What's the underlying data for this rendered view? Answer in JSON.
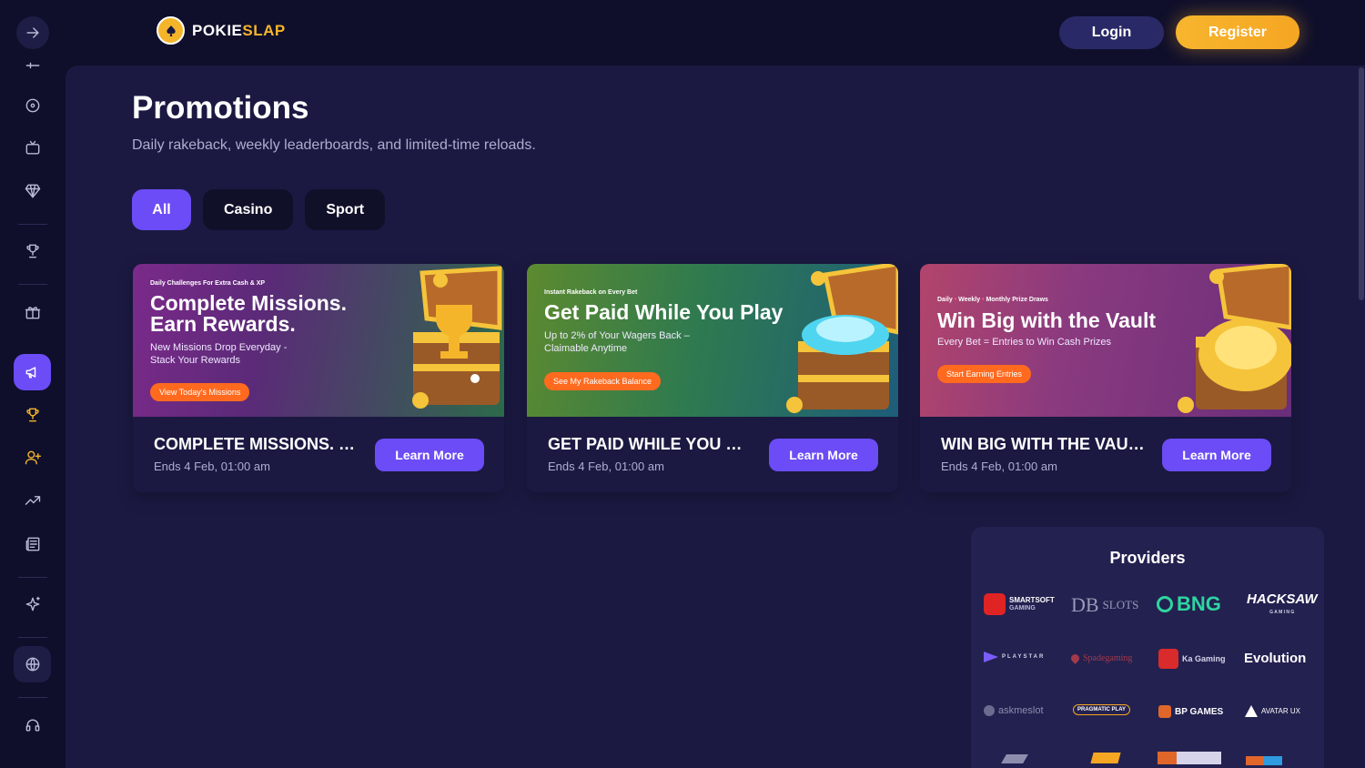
{
  "brand": {
    "name_part1": "POKIE",
    "name_part2": "SLAP"
  },
  "header": {
    "login_label": "Login",
    "register_label": "Register"
  },
  "page": {
    "title": "Promotions",
    "subtitle": "Daily rakeback, weekly leaderboards, and limited-time reloads."
  },
  "tabs": [
    {
      "label": "All",
      "active": true
    },
    {
      "label": "Casino",
      "active": false
    },
    {
      "label": "Sport",
      "active": false
    }
  ],
  "sidebar": {
    "icons": [
      "arrow-right-icon",
      "sliders-icon",
      "roulette-icon",
      "tv-icon",
      "diamond-icon",
      "trophy-icon",
      "gift-icon",
      "megaphone-icon",
      "cup-icon",
      "user-plus-icon",
      "trending-up-icon",
      "newspaper-icon",
      "sparkles-icon",
      "globe-icon",
      "headset-icon"
    ],
    "accent_gold": "#f5b52b",
    "accent_purple": "#6b4cf6"
  },
  "promotions": [
    {
      "kicker": "Daily Challenges For Extra Cash & XP",
      "banner_title_1": "Complete Missions.",
      "banner_title_2": "Earn Rewards.",
      "banner_sub_1": "New Missions Drop Everyday -",
      "banner_sub_2": "Stack Your Rewards",
      "banner_cta": "View Today's Missions",
      "title": "COMPLETE MISSIONS. EARN REWARDS.",
      "ends": "Ends 4 Feb, 01:00 am",
      "button": "Learn More"
    },
    {
      "kicker": "Instant Rakeback on Every Bet",
      "banner_title_1": "Get Paid While You Play",
      "banner_sub_1": "Up to 2% of Your Wagers Back –",
      "banner_sub_2": "Claimable Anytime",
      "banner_cta": "See My Rakeback Balance",
      "title": "GET PAID WHILE YOU PLAY",
      "ends": "Ends 4 Feb, 01:00 am",
      "button": "Learn More"
    },
    {
      "kicker_1": "Daily",
      "kicker_2": "Weekly",
      "kicker_3": "Monthly Prize Draws",
      "banner_title_1": "Win Big with the Vault",
      "banner_sub_1": "Every Bet = Entries to Win Cash Prizes",
      "banner_cta": "Start Earning Entries",
      "title": "WIN BIG WITH THE VAULT",
      "ends": "Ends 4 Feb, 01:00 am",
      "button": "Learn More"
    }
  ],
  "providers": {
    "title": "Providers",
    "items": [
      {
        "name": "SMARTSOFT",
        "sub": "GAMING"
      },
      {
        "name": "DB",
        "sub": "SLOTS"
      },
      {
        "name": "BNG",
        "sub": ""
      },
      {
        "name": "HACKSAW",
        "sub": "G A M I N G"
      },
      {
        "name": "PLAYSTAR",
        "sub": ""
      },
      {
        "name": "Spadegaming",
        "sub": ""
      },
      {
        "name": "Ka Gaming",
        "sub": ""
      },
      {
        "name": "Evolution",
        "sub": ""
      },
      {
        "name": "askmeslot",
        "sub": ""
      },
      {
        "name": "PRAGMATIC PLAY",
        "sub": ""
      },
      {
        "name": "BP GAMES",
        "sub": ""
      },
      {
        "name": "AVATAR UX",
        "sub": ""
      }
    ]
  }
}
